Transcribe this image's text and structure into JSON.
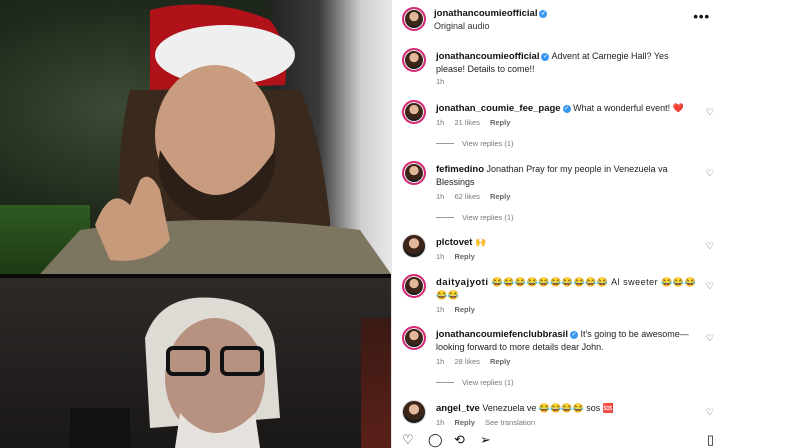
{
  "post": {
    "author": "jonathancoumieofficial",
    "audio": "Original audio",
    "more_icon": "more-horizontal-icon"
  },
  "caption": {
    "author": "jonathancoumieofficial",
    "text": "Advent at Carnegie Hall? Yes please! Details to come!!",
    "time": "1h"
  },
  "comments": [
    {
      "author": "jonathan_coumie_fee_page",
      "verified": true,
      "text": "What a wonderful event! ❤️",
      "time": "1h",
      "likes": "21 likes",
      "reply": "Reply",
      "view_replies": "View replies (1)"
    },
    {
      "author": "fefimedino",
      "verified": false,
      "text": "Jonathan Pray for my people in Venezuela va Blessings",
      "time": "1h",
      "likes": "62 likes",
      "reply": "Reply",
      "view_replies": "View replies (1)"
    },
    {
      "author": "plctovet",
      "verified": false,
      "text": "🙌",
      "time": "1h",
      "likes": "",
      "reply": "Reply",
      "view_replies": ""
    },
    {
      "author": "daityajyoti",
      "verified": false,
      "text": "😂😂😂😂😂😂😂😂😂😂 Al sweeter 😂😂😂😂😂",
      "time": "1h",
      "likes": "",
      "reply": "Reply",
      "view_replies": ""
    },
    {
      "author": "jonathancoumiefenclubbrasil",
      "verified": true,
      "text": "It's going to be awesome—looking forward to more details dear John.",
      "time": "1h",
      "likes": "28 likes",
      "reply": "Reply",
      "view_replies": "View replies (1)"
    },
    {
      "author": "angel_tve",
      "verified": false,
      "text": "Venezuela ve 😂😂😂😂 sos 🆘",
      "time": "1h",
      "likes": "",
      "reply": "Reply",
      "view_replies": "See translation"
    }
  ],
  "actions": {
    "like_icon": "heart-icon",
    "comment_icon": "comment-icon",
    "share_icon": "repost-icon",
    "send_icon": "send-icon",
    "save_icon": "bookmark-icon"
  }
}
